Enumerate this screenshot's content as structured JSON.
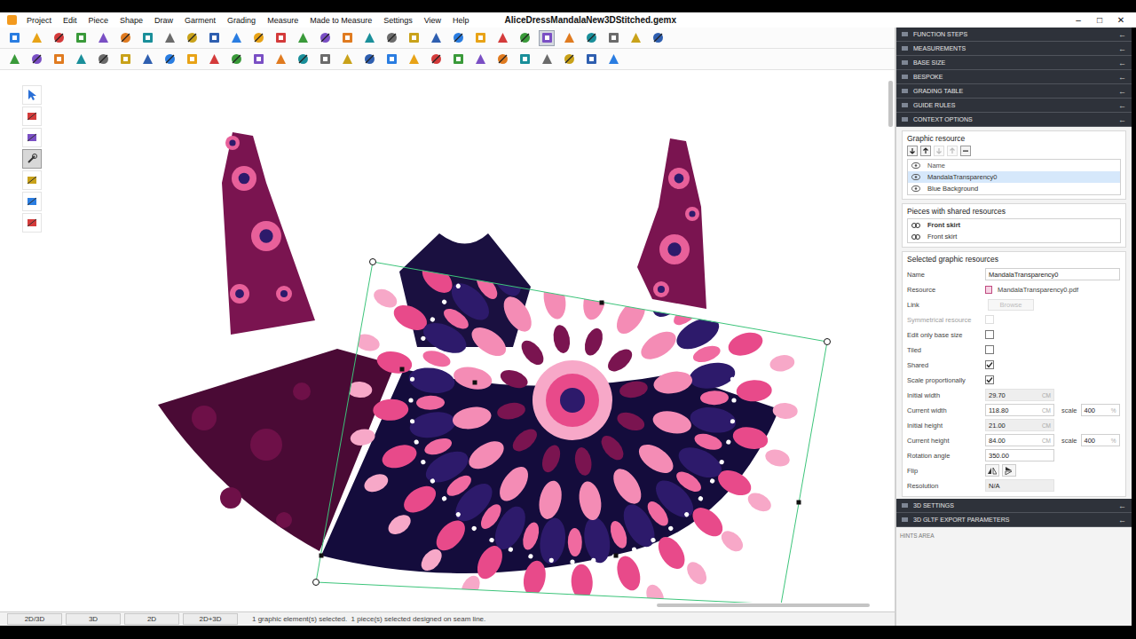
{
  "window": {
    "title": "AliceDressMandalaNew3DStitched.gemx",
    "controls": [
      "–",
      "□",
      "✕"
    ]
  },
  "menu": [
    "Project",
    "Edit",
    "Piece",
    "Shape",
    "Draw",
    "Garment",
    "Grading",
    "Measure",
    "Made to Measure",
    "Settings",
    "View",
    "Help"
  ],
  "toolbar": {
    "rows": [
      [
        {
          "selected": false
        },
        {
          "selected": false
        },
        {
          "selected": false
        },
        {
          "selected": false
        },
        {
          "selected": false
        },
        {
          "selected": false
        },
        {
          "selected": false
        },
        {
          "selected": false
        },
        {
          "selected": false
        },
        {
          "selected": false
        },
        {
          "selected": false
        },
        {
          "selected": false
        },
        {
          "selected": false
        },
        {
          "selected": false
        },
        {
          "selected": false
        },
        {
          "selected": false
        },
        {
          "selected": false
        },
        {
          "selected": false
        },
        {
          "selected": false
        },
        {
          "selected": false
        },
        {
          "selected": false
        },
        {
          "selected": false
        },
        {
          "selected": false
        },
        {
          "selected": false
        },
        {
          "selected": true
        },
        {
          "selected": false
        },
        {
          "selected": false
        },
        {
          "selected": false
        },
        {
          "selected": false
        },
        {
          "selected": false
        }
      ],
      [
        {
          "selected": false
        },
        {
          "selected": false
        },
        {
          "selected": false
        },
        {
          "selected": false
        },
        {
          "selected": false
        },
        {
          "selected": false
        },
        {
          "selected": false
        },
        {
          "selected": false
        },
        {
          "selected": false
        },
        {
          "selected": false
        },
        {
          "selected": false
        },
        {
          "selected": false
        },
        {
          "selected": false
        },
        {
          "selected": false
        },
        {
          "selected": false
        },
        {
          "selected": false
        },
        {
          "selected": false
        },
        {
          "selected": false
        },
        {
          "selected": false
        },
        {
          "selected": false
        },
        {
          "selected": false
        },
        {
          "selected": false
        },
        {
          "selected": false
        },
        {
          "selected": false
        },
        {
          "selected": false
        },
        {
          "selected": false
        },
        {
          "selected": false
        },
        {
          "selected": false
        }
      ]
    ]
  },
  "toolbox": [
    {
      "selected": false
    },
    {
      "selected": false
    },
    {
      "selected": false
    },
    {
      "selected": true
    },
    {
      "selected": false
    },
    {
      "selected": false
    },
    {
      "selected": false
    }
  ],
  "panel": {
    "arrow": "←",
    "sections_top": [
      {
        "label": "FUNCTION STEPS",
        "expanded": false
      },
      {
        "label": "MEASUREMENTS",
        "expanded": false
      },
      {
        "label": "BASE SIZE",
        "expanded": false
      },
      {
        "label": "BESPOKE",
        "expanded": false
      },
      {
        "label": "GRADING TABLE",
        "expanded": false
      },
      {
        "label": "GUIDE RULES",
        "expanded": false
      },
      {
        "label": "CONTEXT OPTIONS",
        "expanded": true
      }
    ],
    "graphic_resource": {
      "title": "Graphic resource",
      "buttons": [
        {
          "disabled": false
        },
        {
          "disabled": false
        },
        {
          "disabled": true
        },
        {
          "disabled": true
        },
        {
          "disabled": false
        }
      ],
      "header": "Name",
      "items": [
        {
          "name": "MandalaTransparency0",
          "selected": true,
          "visible": true
        },
        {
          "name": "Blue Background",
          "selected": false,
          "visible": true
        }
      ]
    },
    "shared": {
      "title": "Pieces with shared resources",
      "items": [
        {
          "name": "Front skirt",
          "selected": true
        },
        {
          "name": "Front skirt",
          "selected": false
        }
      ]
    },
    "properties": {
      "title": "Selected graphic resources",
      "rows": [
        {
          "kind": "text",
          "label": "Name",
          "value": "MandalaTransparency0"
        },
        {
          "kind": "file",
          "label": "Resource",
          "value": "MandalaTransparency0.pdf"
        },
        {
          "kind": "button",
          "label": "Link",
          "value": "Browse",
          "disabled": true
        },
        {
          "kind": "check",
          "label": "Symmetrical resource",
          "checked": false,
          "disabled": true
        },
        {
          "kind": "check",
          "label": "Edit only base size",
          "checked": false,
          "disabled": false
        },
        {
          "kind": "check",
          "label": "Tiled",
          "checked": false,
          "disabled": false
        },
        {
          "kind": "check",
          "label": "Shared",
          "checked": true,
          "disabled": false
        },
        {
          "kind": "check",
          "label": "Scale proportionally",
          "checked": true,
          "disabled": false
        },
        {
          "kind": "number",
          "label": "Initial width",
          "value": "29.70",
          "unit": "CM",
          "disabled": true
        },
        {
          "kind": "scaled",
          "label": "Current width",
          "value": "118.80",
          "unit": "CM",
          "scale_label": "scale",
          "scale": "400",
          "scale_unit": "%"
        },
        {
          "kind": "number",
          "label": "Initial height",
          "value": "21.00",
          "unit": "CM",
          "disabled": true
        },
        {
          "kind": "scaled",
          "label": "Current height",
          "value": "84.00",
          "unit": "CM",
          "scale_label": "scale",
          "scale": "400",
          "scale_unit": "%"
        },
        {
          "kind": "number",
          "label": "Rotation angle",
          "value": "350.00",
          "unit": "",
          "disabled": false
        },
        {
          "kind": "flip",
          "label": "Flip"
        },
        {
          "kind": "number",
          "label": "Resolution",
          "value": "N/A",
          "unit": "",
          "disabled": true
        }
      ]
    },
    "sections_bottom": [
      {
        "label": "3D SETTINGS",
        "expanded": false
      },
      {
        "label": "3D GLTF EXPORT PARAMETERS",
        "expanded": false
      }
    ],
    "hints": "HINTS AREA"
  },
  "view_tabs": [
    {
      "label": "2D/3D",
      "selected": false
    },
    {
      "label": "3D",
      "selected": false
    },
    {
      "label": "2D",
      "selected": false
    },
    {
      "label": "2D+3D",
      "selected": false
    }
  ],
  "status_bar": "1 graphic element(s) selected.  1 piece(s) selected designed on seam line."
}
